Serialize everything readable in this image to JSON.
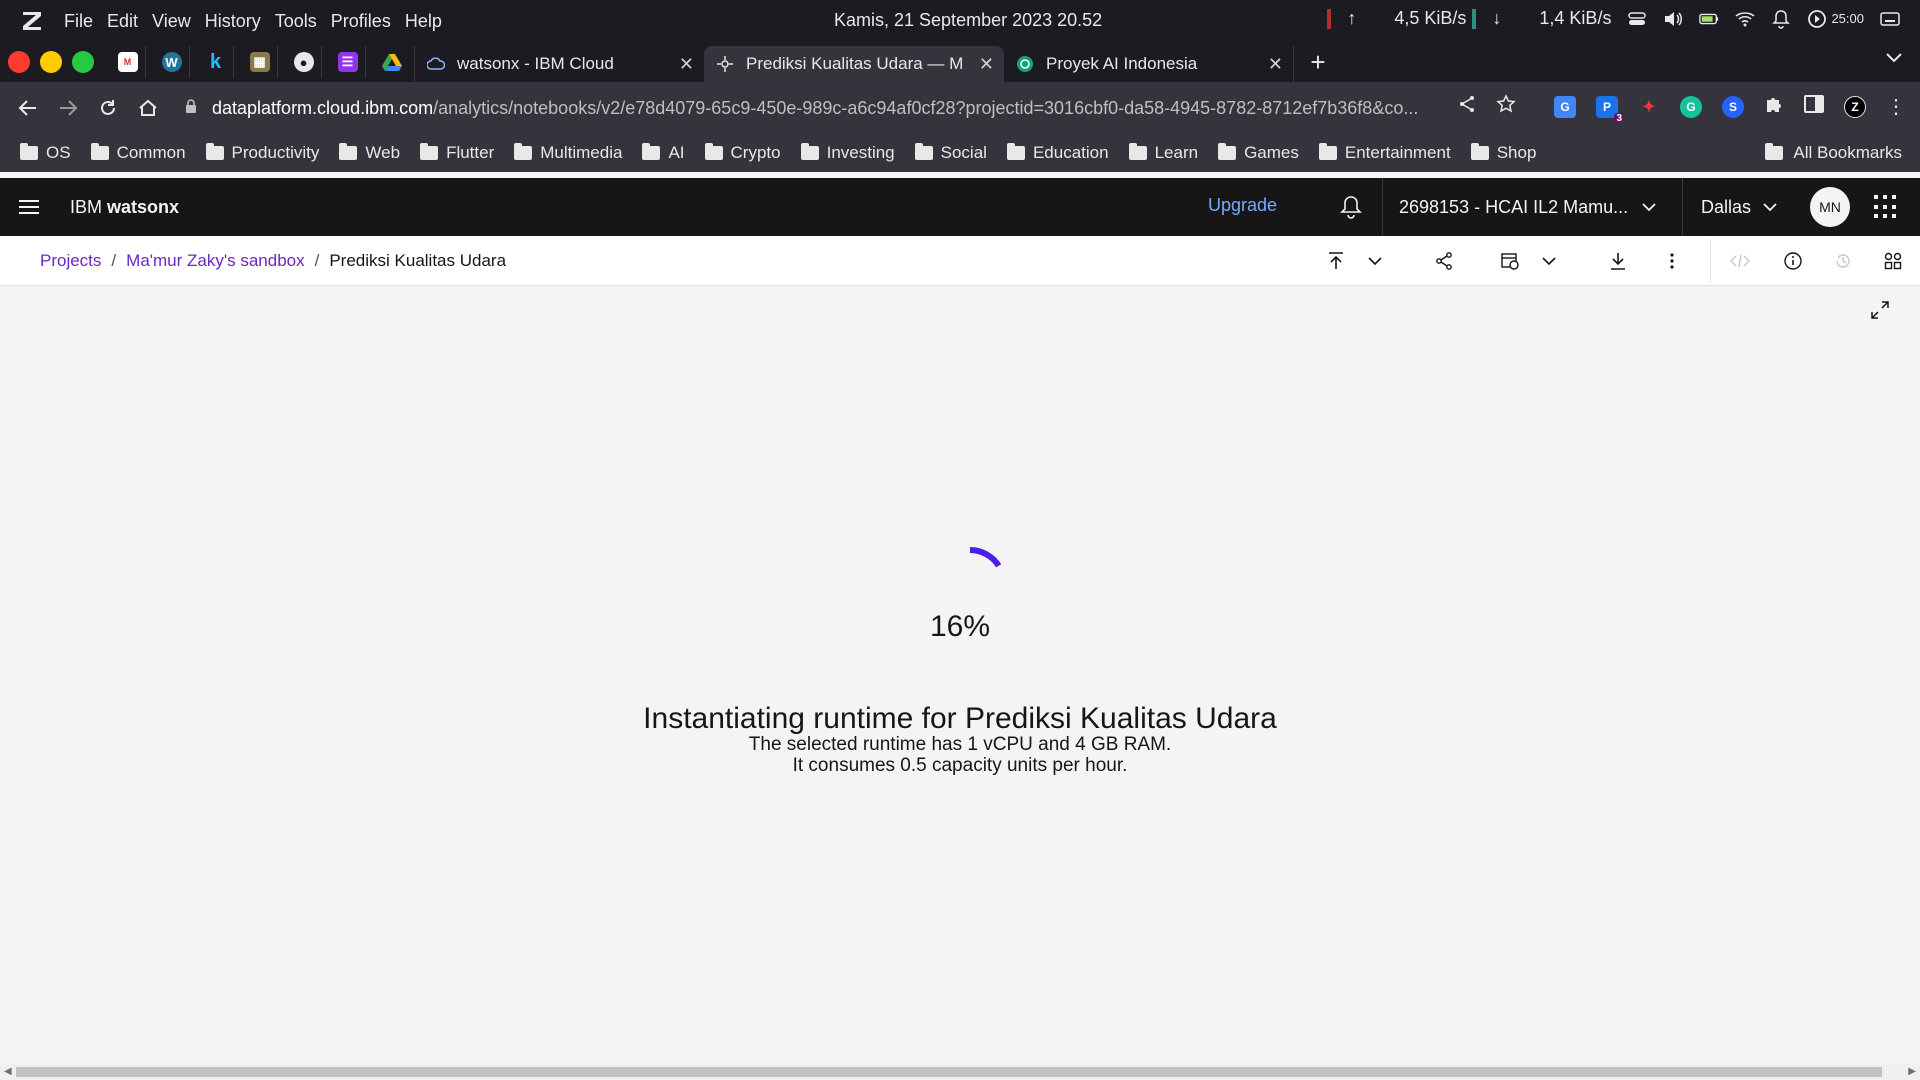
{
  "os": {
    "menu": [
      "File",
      "Edit",
      "View",
      "History",
      "Tools",
      "Profiles",
      "Help"
    ],
    "clock": "Kamis, 21 September 2023  20.52",
    "upload_speed": "4,5 KiB/s",
    "download_speed": "1,4 KiB/s",
    "timer": "25:00"
  },
  "browser": {
    "tabs": [
      {
        "title": "watsonx - IBM Cloud",
        "active": false
      },
      {
        "title": "Prediksi Kualitas Udara — M",
        "active": true
      },
      {
        "title": "Proyek AI Indonesia",
        "active": false
      }
    ],
    "url_host": "dataplatform.cloud.ibm.com",
    "url_path": "/analytics/notebooks/v2/e78d4079-65c9-450e-989c-a6c94af0cf28?projectid=3016cbf0-da58-4945-8782-8712ef7b36f8&co...",
    "ext_badge": "3",
    "bookmarks": [
      "OS",
      "Common",
      "Productivity",
      "Web",
      "Flutter",
      "Multimedia",
      "AI",
      "Crypto",
      "Investing",
      "Social",
      "Education",
      "Learn",
      "Games",
      "Entertainment",
      "Shop"
    ],
    "all_bookmarks": "All Bookmarks"
  },
  "app": {
    "brand_prefix": "IBM",
    "brand_name": "watsonx",
    "upgrade": "Upgrade",
    "account": "2698153 - HCAI IL2 Mamu...",
    "region": "Dallas",
    "avatar": "MN"
  },
  "breadcrumb": {
    "projects": "Projects",
    "sandbox": "Ma'mur Zaky's sandbox",
    "current": "Prediksi Kualitas Udara"
  },
  "loading": {
    "percent": "16%",
    "progress": 0.16,
    "title": "Instantiating runtime for Prediksi Kualitas Udara",
    "line1": "The selected runtime has 1 vCPU and 4 GB RAM.",
    "line2": "It consumes 0.5 capacity units per hour."
  },
  "colors": {
    "accent": "#6929c4",
    "spinner": "#4e1ee8",
    "upgrade": "#78a9ff"
  }
}
